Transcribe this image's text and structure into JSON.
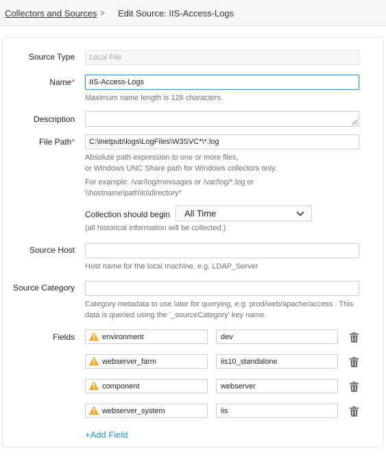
{
  "breadcrumb": {
    "link": "Collectors and Sources",
    "separator": ">",
    "current": "Edit Source: IIS-Access-Logs"
  },
  "form": {
    "source_type": {
      "label": "Source Type",
      "value": "Local File"
    },
    "name": {
      "label": "Name",
      "required": "*",
      "value": "IIS-Access-Logs",
      "help": "Maximum name length is 128 characters."
    },
    "description": {
      "label": "Description",
      "value": ""
    },
    "file_path": {
      "label": "File Path",
      "required": "*",
      "value": "C:\\inetpub\\logs\\LogFiles\\W3SVC*\\*.log",
      "help1": "Absolute path expression to one or more files,",
      "help2": "or Windows UNC Share path for Windows collectors only.",
      "help3": "For example: /var/log/messages or /var/log/*.log or",
      "help4": "\\\\hostname\\path\\to\\directory*"
    },
    "collection": {
      "label": "Collection should begin",
      "selected": "All Time",
      "help": "(all historical information will be collected.)"
    },
    "source_host": {
      "label": "Source Host",
      "value": "",
      "help": "Host name for the local machine, e.g. LDAP_Server"
    },
    "source_category": {
      "label": "Source Category",
      "value": "",
      "help1": "Category metadata to use later for querying, e.g. prod/web/apache/access . This",
      "help2": "data is queried using the '_sourceCategory' key name."
    },
    "fields": {
      "label": "Fields",
      "rows": [
        {
          "key": "environment",
          "value": "dev"
        },
        {
          "key": "webserver_farm",
          "value": "iis10_standalone"
        },
        {
          "key": "component",
          "value": "webserver"
        },
        {
          "key": "webserver_system",
          "value": "iis"
        }
      ],
      "add_label": "+Add Field"
    }
  },
  "colors": {
    "accent": "#2d8fd5",
    "required": "#d9383a",
    "warning": "#f0a830"
  },
  "icons": [
    "warning-triangle-icon",
    "trash-icon",
    "chevron-down-icon"
  ]
}
